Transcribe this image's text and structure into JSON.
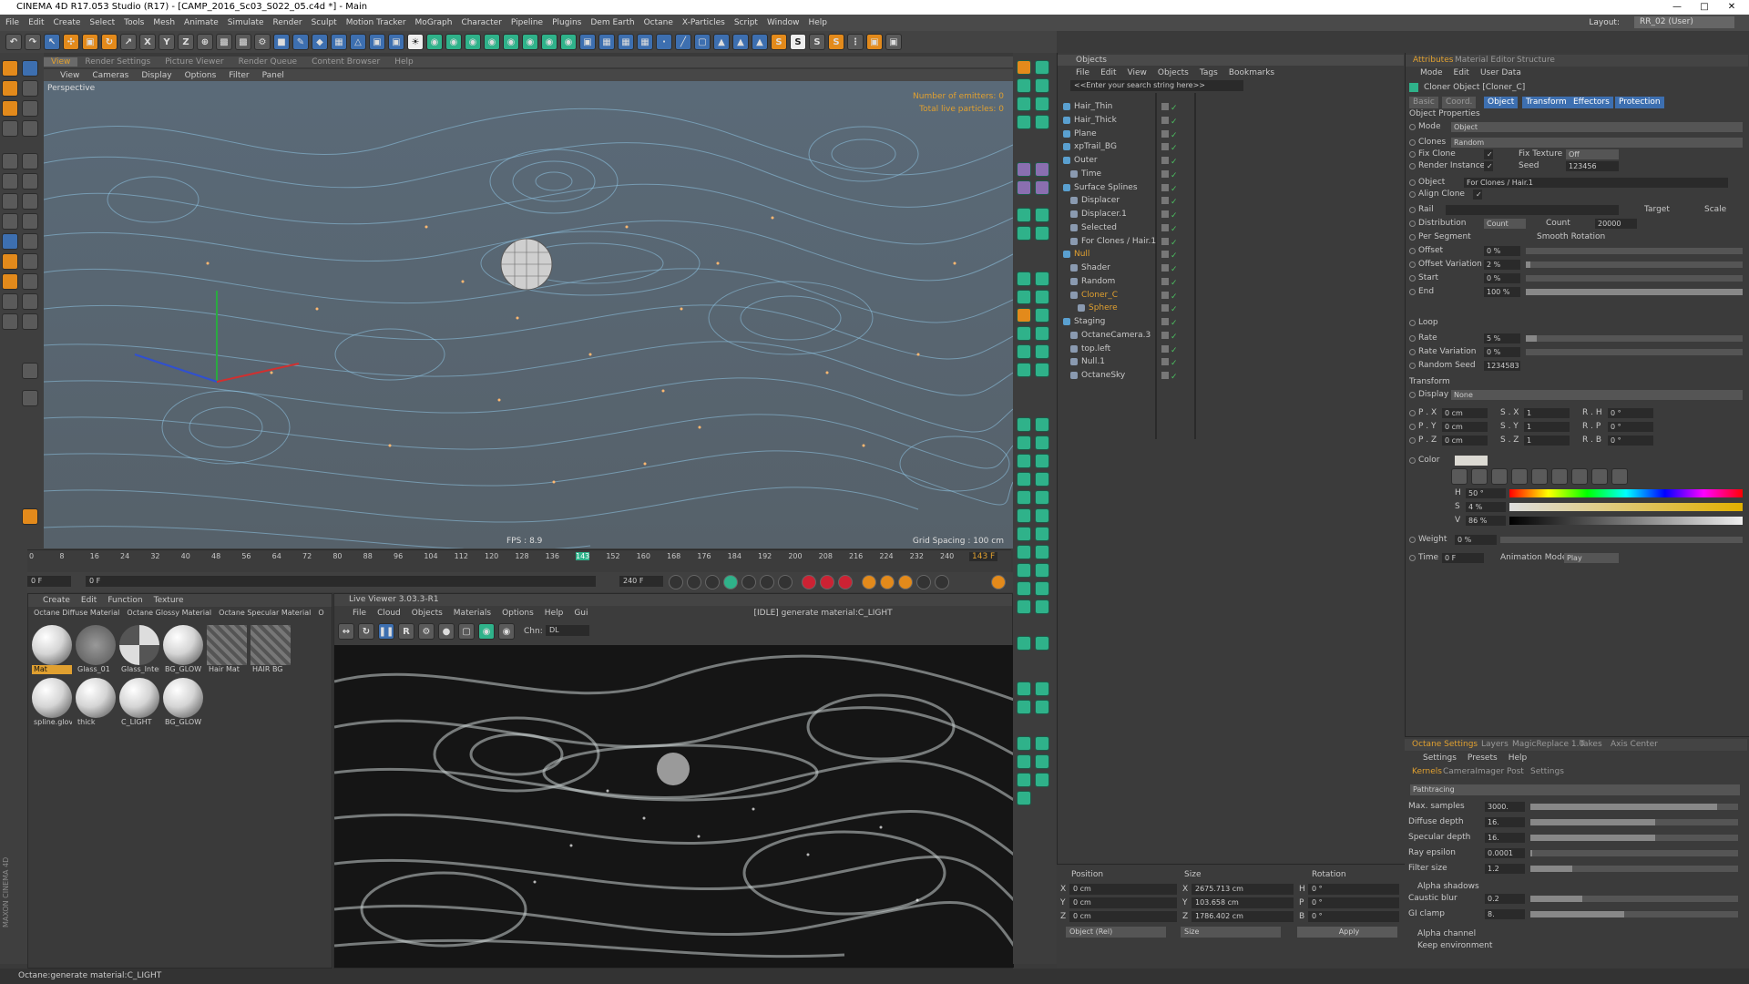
{
  "window": {
    "title": "CINEMA 4D R17.053 Studio (R17) - [CAMP_2016_Sc03_S022_05.c4d *] - Main"
  },
  "menu": [
    "File",
    "Edit",
    "Create",
    "Select",
    "Tools",
    "Mesh",
    "Animate",
    "Simulate",
    "Render",
    "Sculpt",
    "Motion Tracker",
    "MoGraph",
    "Character",
    "Pipeline",
    "Plugins",
    "Dem Earth",
    "Octane",
    "X-Particles",
    "Script",
    "Window",
    "Help"
  ],
  "layout": {
    "label": "Layout:",
    "value": "RR_02 (User)"
  },
  "viewport": {
    "tabs": [
      "View",
      "Render Settings",
      "Picture Viewer",
      "Render Queue",
      "Content Browser",
      "Help"
    ],
    "menu": [
      "View",
      "Cameras",
      "Display",
      "Options",
      "Filter",
      "Panel"
    ],
    "camera": "Perspective",
    "emitters": "Number of emitters: 0",
    "particles": "Total live particles: 0",
    "fps": "FPS : 8.9",
    "grid": "Grid Spacing : 100 cm"
  },
  "timeline": {
    "ticks": [
      "0",
      "8",
      "16",
      "24",
      "32",
      "40",
      "48",
      "56",
      "64",
      "72",
      "80",
      "88",
      "96",
      "104",
      "112",
      "120",
      "128",
      "136",
      "143",
      "152",
      "160",
      "168",
      "176",
      "184",
      "192",
      "200",
      "208",
      "216",
      "224",
      "232",
      "240"
    ],
    "current_frame": 143,
    "current_label": "143 F",
    "start": "0 F",
    "start2": "0 F",
    "end": "240 F",
    "end2": "240 F"
  },
  "material_manager": {
    "menu": [
      "Create",
      "Edit",
      "Function",
      "Texture"
    ],
    "tabs": [
      "Octane Diffuse Material",
      "Octane Glossy Material",
      "Octane Specular Material",
      "O"
    ],
    "materials": [
      "Mat",
      "Glass_01",
      "Glass_Inter",
      "BG_GLOW",
      "Hair Mat",
      "HAIR BG",
      "spline.glov",
      "thick",
      "C_LIGHT",
      "BG_GLOW"
    ]
  },
  "live_viewer": {
    "title": "Live Viewer 3.03.3-R1",
    "menu": [
      "File",
      "Cloud",
      "Objects",
      "Materials",
      "Options",
      "Help",
      "Gui"
    ],
    "status": "[IDLE] generate material:C_LIGHT",
    "channel_label": "Chn:",
    "channel": "DL"
  },
  "objects": {
    "title": "Objects",
    "menu": [
      "File",
      "Edit",
      "View",
      "Objects",
      "Tags",
      "Bookmarks"
    ],
    "search_placeholder": "<<Enter your search string here>>",
    "items": [
      {
        "name": "Hair_Thin",
        "depth": 0
      },
      {
        "name": "Hair_Thick",
        "depth": 0
      },
      {
        "name": "Plane",
        "depth": 0
      },
      {
        "name": "xpTrail_BG",
        "depth": 0
      },
      {
        "name": "Outer",
        "depth": 0
      },
      {
        "name": "Time",
        "depth": 1
      },
      {
        "name": "Surface Splines",
        "depth": 0
      },
      {
        "name": "Displacer",
        "depth": 1
      },
      {
        "name": "Displacer.1",
        "depth": 1
      },
      {
        "name": "Selected",
        "depth": 1
      },
      {
        "name": "For Clones / Hair.1",
        "depth": 1
      },
      {
        "name": "Null",
        "depth": 0
      },
      {
        "name": "Shader",
        "depth": 1
      },
      {
        "name": "Random",
        "depth": 1
      },
      {
        "name": "Cloner_C",
        "depth": 1
      },
      {
        "name": "Sphere",
        "depth": 2
      },
      {
        "name": "Staging",
        "depth": 0
      },
      {
        "name": "OctaneCamera.3",
        "depth": 1
      },
      {
        "name": "top.left",
        "depth": 1
      },
      {
        "name": "Null.1",
        "depth": 1
      },
      {
        "name": "OctaneSky",
        "depth": 1
      }
    ]
  },
  "coords": {
    "headers": [
      "Position",
      "Size",
      "Rotation"
    ],
    "rows": [
      {
        "axis": "X",
        "pos": "0 cm",
        "size_axis": "X",
        "size": "2675.713 cm",
        "rot_axis": "H",
        "rot": "0 °"
      },
      {
        "axis": "Y",
        "pos": "0 cm",
        "size_axis": "Y",
        "size": "103.658 cm",
        "rot_axis": "P",
        "rot": "0 °"
      },
      {
        "axis": "Z",
        "pos": "0 cm",
        "size_axis": "Z",
        "size": "1786.402 cm",
        "rot_axis": "B",
        "rot": "0 °"
      }
    ],
    "mode1": "Object (Rel)",
    "mode2": "Size",
    "apply": "Apply"
  },
  "attributes": {
    "tabs": [
      "Attributes",
      "Material Editor",
      "Structure"
    ],
    "menu": [
      "Mode",
      "Edit",
      "User Data"
    ],
    "object_title": "Cloner Object [Cloner_C]",
    "subtabs": [
      "Basic",
      "Coord.",
      "Object",
      "Transform",
      "Effectors",
      "Protection"
    ],
    "section_props": "Object Properties",
    "mode_label": "Mode",
    "mode_value": "Object",
    "clones_label": "Clones",
    "clones_value": "Random",
    "fix_clone": "Fix Clone",
    "fix_texture": "Fix Texture",
    "fix_texture_value": "Off",
    "render_instances": "Render Instances",
    "seed_label": "Seed",
    "seed_value": "123456",
    "object_label": "Object",
    "object_value": "For Clones / Hair.1",
    "align_clone": "Align Clone",
    "rail": "Rail",
    "target": "Target",
    "scale": "Scale",
    "distribution": "Distribution",
    "distribution_value": "Count",
    "count": "Count",
    "count_value": "20000",
    "per_segment": "Per Segment",
    "smooth_rotation": "Smooth Rotation",
    "params": [
      {
        "label": "Offset",
        "value": "0 %",
        "frac": 0.0
      },
      {
        "label": "Offset Variation",
        "value": "2 %",
        "frac": 0.02
      },
      {
        "label": "Start",
        "value": "0 %",
        "frac": 0.0
      },
      {
        "label": "End",
        "value": "100 %",
        "frac": 1.0
      }
    ],
    "loop": "Loop",
    "rate": "Rate",
    "rate_value": "5 %",
    "rate_var": "Rate Variation",
    "rate_var_value": "0 %",
    "random_seed": "Random Seed",
    "random_seed_value": "1234583",
    "section_transform": "Transform",
    "display": "Display",
    "display_value": "None",
    "px": "P . X",
    "px_v": "0 cm",
    "py": "P . Y",
    "py_v": "0 cm",
    "pz": "P . Z",
    "pz_v": "0 cm",
    "sx": "S . X",
    "sx_v": "1",
    "sy": "S . Y",
    "sy_v": "1",
    "sz": "S . Z",
    "sz_v": "1",
    "rh": "R . H",
    "rh_v": "0 °",
    "rp": "R . P",
    "rp_v": "0 °",
    "rb": "R . B",
    "rb_v": "0 °",
    "color": "Color",
    "h": "H",
    "h_v": "50 °",
    "s": "S",
    "s_v": "4 %",
    "v": "V",
    "v_v": "86 %",
    "weight": "Weight",
    "weight_v": "0 %",
    "time": "Time",
    "time_v": "0 F",
    "anim_mode": "Animation Mode",
    "anim_mode_v": "Play"
  },
  "octane": {
    "tabs": [
      "Octane Settings",
      "Layers",
      "MagicReplace 1.0",
      "Takes",
      "Axis Center"
    ],
    "menu": [
      "Settings",
      "Presets",
      "Help"
    ],
    "subtabs": [
      "Kernels",
      "CameraImager",
      "Post",
      "Settings"
    ],
    "kernel": "Pathtracing",
    "params": [
      {
        "label": "Max. samples",
        "value": "3000.",
        "frac": 0.9
      },
      {
        "label": "Diffuse depth",
        "value": "16.",
        "frac": 0.6
      },
      {
        "label": "Specular depth",
        "value": "16.",
        "frac": 0.6
      },
      {
        "label": "Ray epsilon",
        "value": "0.0001",
        "frac": 0.01
      },
      {
        "label": "Filter size",
        "value": "1.2",
        "frac": 0.2
      }
    ],
    "alpha_shadows": "Alpha shadows",
    "caustic_blur": "Caustic blur",
    "caustic_blur_v": "0.2",
    "gi_clamp": "GI clamp",
    "gi_clamp_v": "8.",
    "alpha_channel": "Alpha channel",
    "keep_env": "Keep environment"
  },
  "status": "Octane:generate material:C_LIGHT",
  "accent": "#e0a030"
}
